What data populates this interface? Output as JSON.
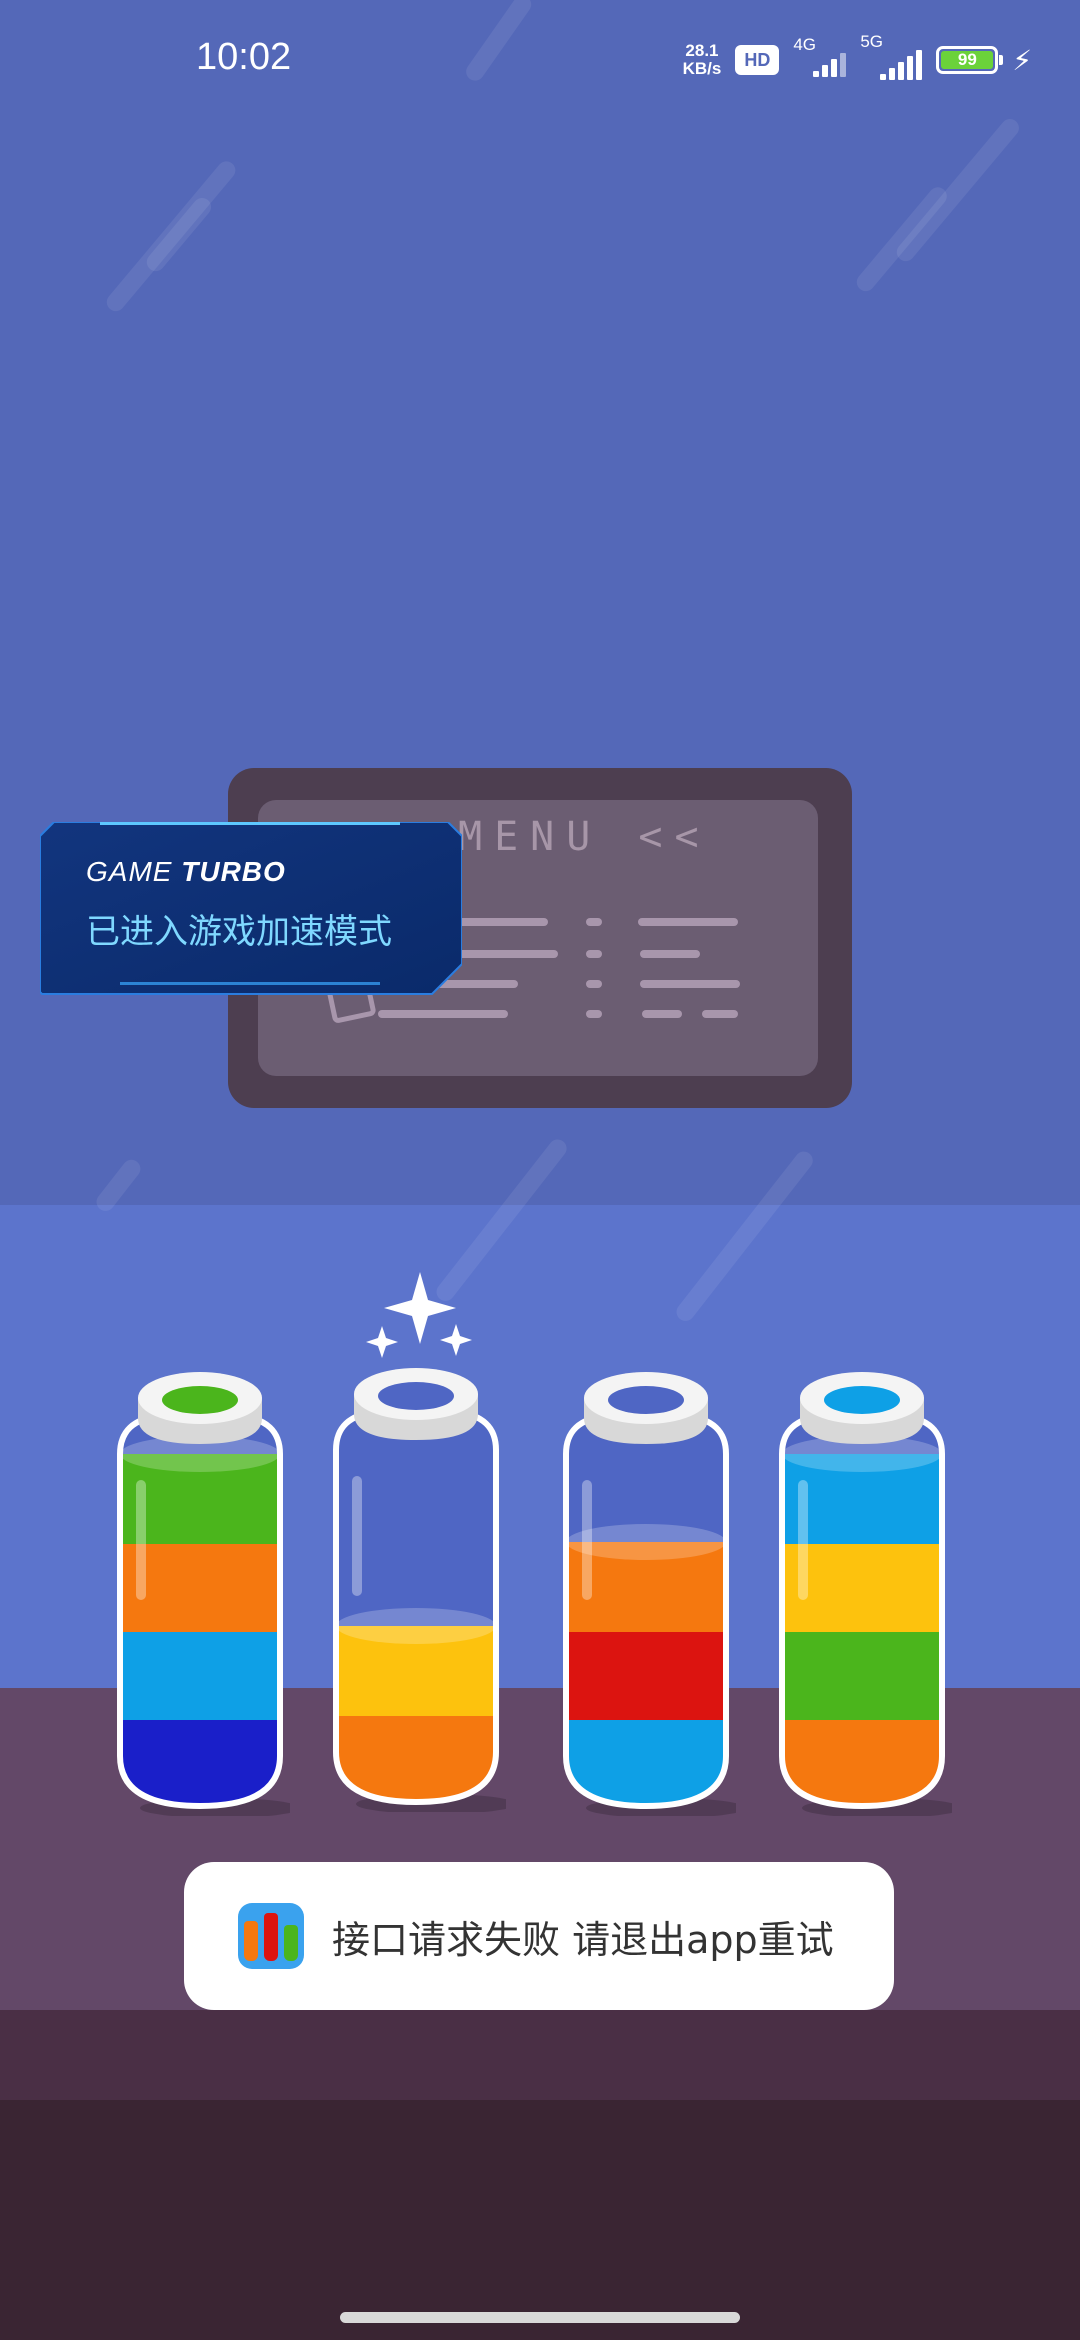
{
  "status_bar": {
    "time": "10:02",
    "net_speed_value": "28.1",
    "net_speed_unit": "KB/s",
    "hd_label": "HD",
    "signal1_tag": "4G",
    "signal2_tag": "5G",
    "battery_level": "99",
    "icons": [
      "hd-icon",
      "signal-4g-icon",
      "signal-5g-icon",
      "battery-icon",
      "charging-bolt-icon"
    ]
  },
  "menu_board": {
    "title": "MENU <<"
  },
  "game_turbo": {
    "brand_light": "GAME",
    "brand_bold": "TURBO",
    "message": "已进入游戏加速模式"
  },
  "bottles": [
    {
      "layers_bottom_to_top": [
        "#1a1fc9",
        "#0ea0e6",
        "#f5780f",
        "#4bb51c"
      ],
      "selected": false
    },
    {
      "layers_bottom_to_top": [
        "#f5780f",
        "#fdc20d"
      ],
      "selected": true
    },
    {
      "layers_bottom_to_top": [
        "#0ea0e6",
        "#dc1410",
        "#f5780f"
      ],
      "selected": false
    },
    {
      "layers_bottom_to_top": [
        "#f5780f",
        "#4bb51c",
        "#fdc20d",
        "#0ea0e6"
      ],
      "selected": false
    }
  ],
  "toast": {
    "app_icon": "water-sort-app-icon",
    "message": "接口请求失败 请退出app重试"
  }
}
